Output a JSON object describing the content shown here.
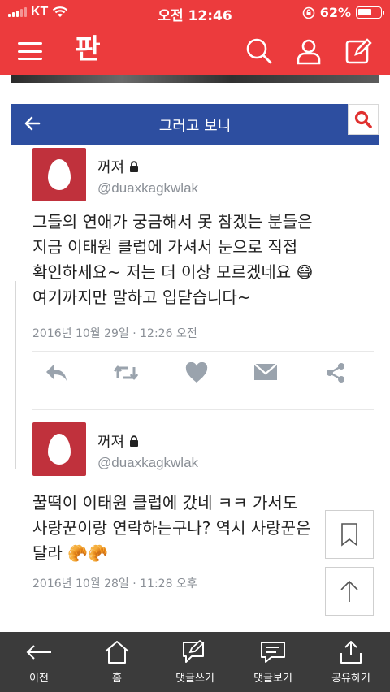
{
  "status_bar": {
    "carrier": "KT",
    "time": "오전 12:46",
    "battery": "62%",
    "battery_level": 0.62
  },
  "app_header": {
    "logo": "판",
    "icons": [
      "menu-icon",
      "search-icon",
      "user-icon",
      "write-icon"
    ]
  },
  "embedded": {
    "title": "그러고 보니"
  },
  "tweets": [
    {
      "username": "꺼져",
      "handle": "@duaxkagkwlak",
      "text": "그들의 연애가 궁금해서 못 참겠는 분들은\n지금 이태원 클럽에 가셔서 눈으로 직접\n확인하세요~ 저는 더 이상 모르겠네요 😷\n여기까지만 말하고 입닫습니다~",
      "date": "2016년 10월 29일 · 12:26 오전"
    },
    {
      "username": "꺼져",
      "handle": "@duaxkagkwlak",
      "text": "꿀떡이 이태원 클럽에 갔네 ㅋㅋ 가서도\n사랑꾼이랑 연락하는구나? 역시 사랑꾼은\n달라 🥐🥐",
      "date": "2016년 10월 28일 · 11:28 오후"
    }
  ],
  "bottom_nav": [
    {
      "label": "이전",
      "icon": "back-arrow-icon"
    },
    {
      "label": "홈",
      "icon": "home-icon"
    },
    {
      "label": "댓글쓰기",
      "icon": "compose-comment-icon"
    },
    {
      "label": "댓글보기",
      "icon": "comments-icon"
    },
    {
      "label": "공유하기",
      "icon": "share-icon"
    }
  ],
  "colors": {
    "header_red": "#ec3b3d",
    "embedded_blue": "#2d4ea0",
    "bottom_bar": "#3b3b3b",
    "avatar_red": "#c0313c"
  }
}
